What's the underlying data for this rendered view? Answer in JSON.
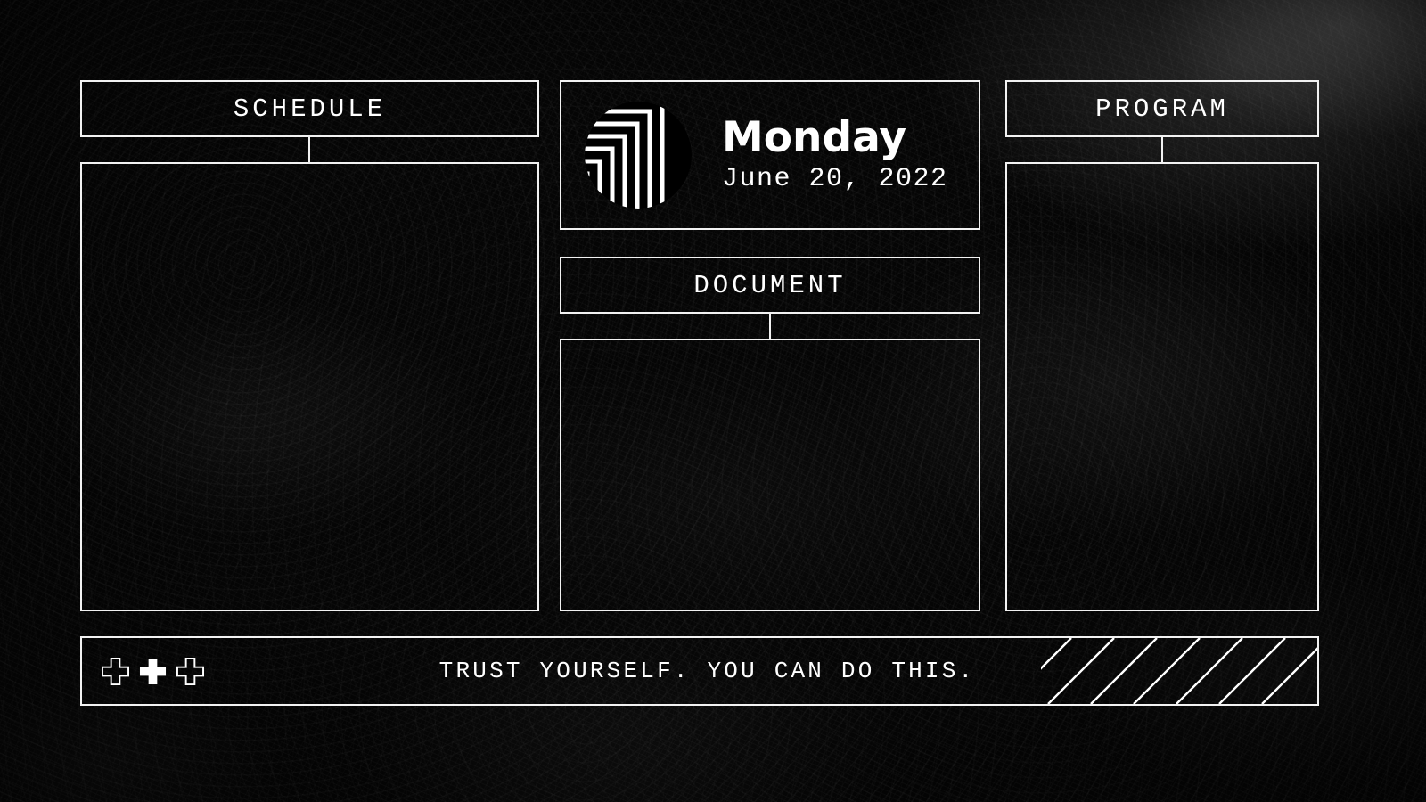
{
  "theme": {
    "background": "#050505",
    "stroke": "#f2f2f2",
    "text": "#ffffff"
  },
  "header": {
    "logo_icon": "concentric-corner-circle-logo",
    "day_name": "Monday",
    "full_date": "June 20, 2022"
  },
  "panels": {
    "schedule": {
      "title": "SCHEDULE",
      "body": ""
    },
    "document": {
      "title": "DOCUMENT",
      "body": ""
    },
    "program": {
      "title": "PROGRAM",
      "body": ""
    }
  },
  "footer": {
    "quote": "TRUST YOURSELF. YOU CAN DO THIS.",
    "crosses": [
      {
        "name": "cross-icon-outline-left",
        "filled": false
      },
      {
        "name": "cross-icon-filled-center",
        "filled": true
      },
      {
        "name": "cross-icon-outline-right",
        "filled": false
      }
    ],
    "stripe_decoration": "diagonal-stripes",
    "stripe_count": 6
  }
}
